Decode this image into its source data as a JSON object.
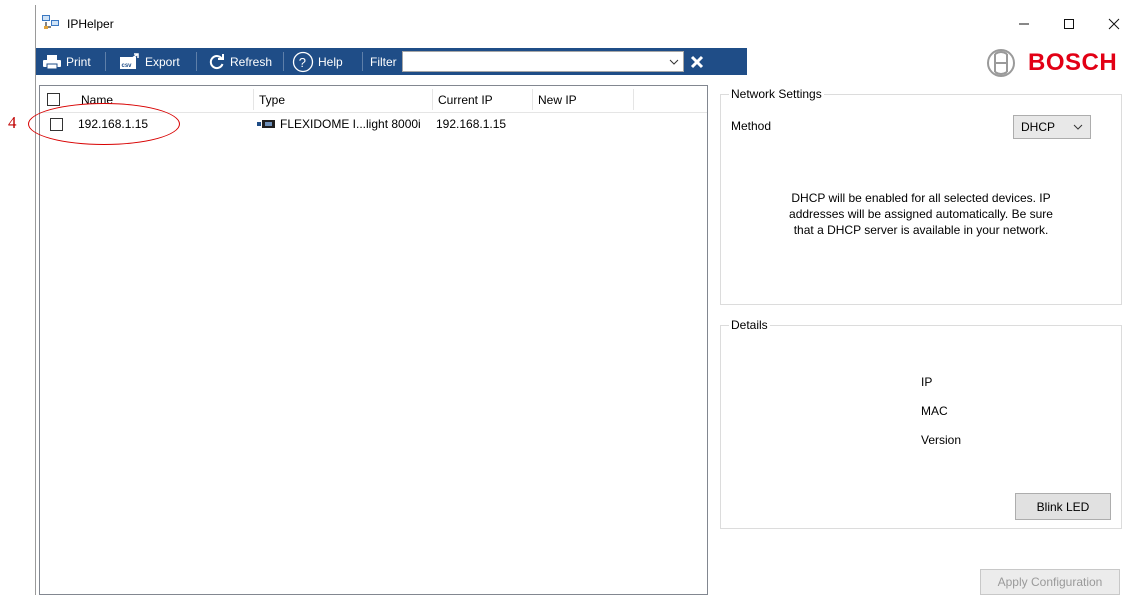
{
  "window": {
    "title": "IPHelper"
  },
  "toolbar": {
    "print_label": "Print",
    "export_label": "Export",
    "refresh_label": "Refresh",
    "help_label": "Help",
    "filter_label": "Filter",
    "filter_value": ""
  },
  "brand": {
    "name": "BOSCH",
    "color": "#e20015",
    "toolbar_color": "#1f4d87"
  },
  "device_list": {
    "columns": [
      "Name",
      "Type",
      "Current IP",
      "New IP"
    ],
    "rows": [
      {
        "name": "192.168.1.15",
        "type": "FLEXIDOME I...light 8000i",
        "current_ip": "192.168.1.15",
        "new_ip": ""
      }
    ]
  },
  "annotation": {
    "number": "4",
    "color": "#d80000"
  },
  "network_settings": {
    "title": "Network Settings",
    "method_label": "Method",
    "method_value": "DHCP",
    "message": "DHCP will be enabled for all selected devices. IP addresses will be assigned automatically. Be sure that a DHCP server is available in your network."
  },
  "details": {
    "title": "Details",
    "ip_label": "IP",
    "mac_label": "MAC",
    "version_label": "Version",
    "blink_label": "Blink LED"
  },
  "apply_label": "Apply Configuration"
}
